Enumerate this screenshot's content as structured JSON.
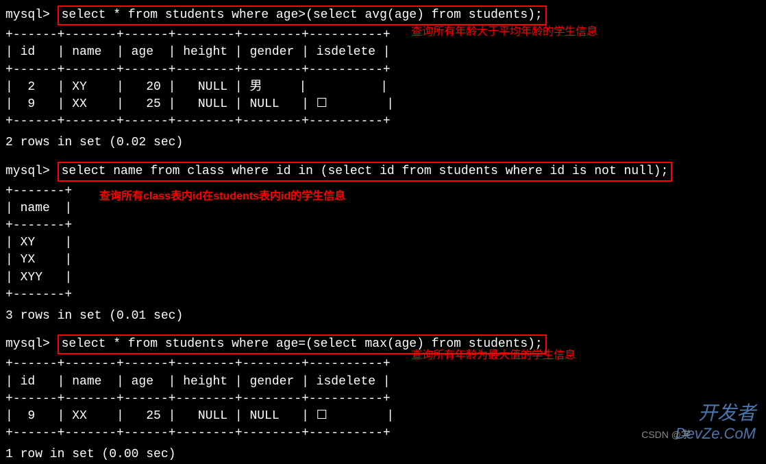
{
  "prompt": "mysql> ",
  "query1": {
    "sql": "select * from students where age>(select avg(age) from students);",
    "annotation": "查询所有年龄大于平均年龄的学生信息",
    "sep": "+------+-------+------+--------+--------+----------+",
    "header": "| id   | name  | age  | height | gender | isdelete |",
    "row1": "|  2   | XY    |   20 |   NULL | 男     |          |",
    "row2": "|  9   | XX    |   25 |   NULL | NULL   | ☐        |",
    "status": "2 rows in set (0.02 sec)"
  },
  "query2": {
    "sql": "select name from class where id in (select id from students where id is not null);",
    "annotation": "查询所有class表内id在students表内id的学生信息",
    "sep": "+-------+",
    "header": "| name  |",
    "row1": "| XY    |",
    "row2": "| YX    |",
    "row3": "| XYY   |",
    "status": "3 rows in set (0.01 sec)"
  },
  "query3": {
    "sql": "select * from students where age=(select max(age) from students);",
    "annotation": "查询所有年龄为最大值的学生信息",
    "sep": "+------+-------+------+--------+--------+----------+",
    "header": "| id   | name  | age  | height | gender | isdelete |",
    "row1": "|  9   | XX    |   25 |   NULL | NULL   | ☐        |",
    "status": "1 row in set (0.00 sec)"
  },
  "watermark": {
    "cn": "开发者",
    "en": "DevZe.CoM",
    "csdn": "CSDN @学"
  }
}
